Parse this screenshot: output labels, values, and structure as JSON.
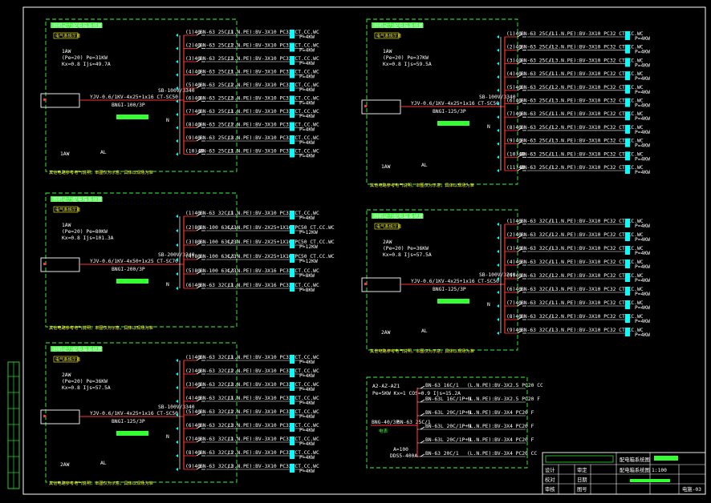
{
  "colors": {
    "background": "#000000",
    "frame": "#ffffff",
    "panel_border": "#33ff33",
    "bus": "#ff3333",
    "breaker": "#ffffff",
    "arrow": "#00ffff",
    "tag": "#00ffff",
    "yellow_text": "#ffff33",
    "green_text": "#33ff33",
    "label_box": "#ffff33"
  },
  "panels": [
    {
      "id": "panel-1",
      "header": "照明动力配电箱系统图",
      "sub_header": "电气系统示意",
      "note": "其他电路参考电气说明，本图仅为示意，具体以现场为准",
      "load_info": [
        "1AW",
        "(Pe=20) Pe=31KW",
        "Kx=0.8 Ijs=49.7A"
      ],
      "feeder_cable": "YJV-0.6/1KV-4x25+1x16 CT-SC50",
      "main_breaker": "BNGI-100/3P",
      "spd": "SB-100V/3340",
      "bus_label": "BNGI-100/3P",
      "footer_tag": "1AW",
      "footer_code": "AL",
      "circuits": [
        {
          "breaker": "(1)40",
          "device": "BN-63 25C/1",
          "desc": "L1.N.PE):BV-3X10 PC32 CT.CC.WC",
          "load": "P=4KW"
        },
        {
          "breaker": "(2)40",
          "device": "BN-63 25C/1",
          "desc": "L2.N.PE):BV-3X10 PC32 CT.CC.WC",
          "load": "P=4KW"
        },
        {
          "breaker": "(3)40",
          "device": "BN-63 25C/1",
          "desc": "L3.N.PE):BV-3X10 PC32 CT.CC.WC",
          "load": "P=4KW"
        },
        {
          "breaker": "(4)40",
          "device": "BN-63 25C/1",
          "desc": "L1.N.PE):BV-3X10 PC32 CT.CC.WC",
          "load": "P=4KW"
        },
        {
          "breaker": "(5)40",
          "device": "BN-63 25C/1",
          "desc": "L2.N.PE):BV-3X10 PC32 CT.CC.WC",
          "load": "P=4KW"
        },
        {
          "breaker": "(6)40",
          "device": "BN-63 25C/1",
          "desc": "L3.N.PE):BV-3X10 PC32 CT.CC.WC",
          "load": "P=4KW"
        },
        {
          "breaker": "(7)40",
          "device": "BN-63 25C/1",
          "desc": "L1.N.PE):BV-3X10 PC32 CT.CC.WC",
          "load": "P=4KW"
        },
        {
          "breaker": "(8)40",
          "device": "BN-63 25C/1",
          "desc": "L2.N.PE):BV-3X10 PC32 CT.CC.WC",
          "load": "P=4KW"
        },
        {
          "breaker": "(9)40",
          "device": "BN-63 25C/1",
          "desc": "L3.N.PE):BV-3X10 PC32 CT.CC.WC",
          "load": "P=4KW"
        },
        {
          "breaker": "(10)40",
          "device": "BN-63 25C/1",
          "desc": "L1.N.PE):BV-3X10 PC32 CT.CC.WC",
          "load": "P=4KW"
        }
      ]
    },
    {
      "id": "panel-2",
      "header": "照明动力配电箱系统图",
      "sub_header": "电气系统示意",
      "note": "其他电路参考电气说明，本图仅为示意，具体以现场为准",
      "load_info": [
        "1AW",
        "(Pe=20) Pe=80KW",
        "Kx=0.8 Ijs=101.3A"
      ],
      "feeder_cable": "YJV-0.6/1KV-4x50+1x25 CT-SC70",
      "main_breaker": "BNGI-200/3P",
      "spd": "SB-200V/3340",
      "bus_label": "BNGI-200/3P",
      "footer_tag": "",
      "footer_code": "",
      "circuits": [
        {
          "breaker": "(1)40",
          "device": "BN-63 32C/1",
          "desc": "L1.N.PE):BV-3X10 PC32 CT.CC.WC",
          "load": "P=4KW"
        },
        {
          "breaker": "(2)80",
          "device": "BN-100 63C/3",
          "desc": "L1.N.PE):BV-2X25+1X16 PC50 CT.CC.WC",
          "load": "P=12KW"
        },
        {
          "breaker": "(3)80",
          "device": "BN-100 63C/3",
          "desc": "L2.N.PE):BV-2X25+1X16 PC50 CT.CC.WC",
          "load": "P=12KW"
        },
        {
          "breaker": "(4)80",
          "device": "BN-100 63C/3",
          "desc": "L3.N.PE):BV-2X25+1X16 PC50 CT.CC.WC",
          "load": "P=12KW"
        },
        {
          "breaker": "(5)80",
          "device": "BN-100 63C/3",
          "desc": "L3.N.PE):BV-3X16 PC32 CT.CC.WC",
          "load": "P=8KW"
        },
        {
          "breaker": "(6)40",
          "device": "BN-63 32C/1",
          "desc": "L1.N.PE):BV-3X16 PC32 CT.CC.WC",
          "load": "P=8KW"
        }
      ]
    },
    {
      "id": "panel-3",
      "header": "照明动力配电箱系统图",
      "sub_header": "电气系统示意",
      "note": "其他电路参考电气说明，本图仅为示意，具体以现场为准",
      "load_info": [
        "2AW",
        "(Pe=20) Pe=36KW",
        "Kx=0.8 Ijs=57.5A"
      ],
      "feeder_cable": "YJV-0.6/1KV-4x25+1x16 CT-SC50",
      "main_breaker": "BNGI-125/3P",
      "spd": "SB-100V/3340",
      "bus_label": "BNGI-125/3P",
      "footer_tag": "2AW",
      "footer_code": "AL",
      "circuits": [
        {
          "breaker": "(1)40",
          "device": "BN-63 32C/1",
          "desc": "L1.N.PE):BV-3X10 PC32 CT.CC.WC",
          "load": "P=4KW"
        },
        {
          "breaker": "(2)40",
          "device": "BN-63 32C/1",
          "desc": "L2.N.PE):BV-3X10 PC32 CT.CC.WC",
          "load": "P=4KW"
        },
        {
          "breaker": "(3)40",
          "device": "BN-63 32C/1",
          "desc": "L3.N.PE):BV-3X10 PC32 CT.CC.WC",
          "load": "P=4KW"
        },
        {
          "breaker": "(4)40",
          "device": "BN-63 32C/1",
          "desc": "L1.N.PE):BV-3X10 PC32 CT.CC.WC",
          "load": "P=4KW"
        },
        {
          "breaker": "(5)40",
          "device": "BN-63 32C/1",
          "desc": "L2.N.PE):BV-3X10 PC32 CT.CC.WC",
          "load": "P=4KW"
        },
        {
          "breaker": "(6)40",
          "device": "BN-63 32C/1",
          "desc": "L3.N.PE):BV-3X10 PC32 CT.CC.WC",
          "load": "P=4KW"
        },
        {
          "breaker": "(7)40",
          "device": "BN-63 32C/1",
          "desc": "L1.N.PE):BV-3X10 PC32 CT.CC.WC",
          "load": "P=4KW"
        },
        {
          "breaker": "(8)40",
          "device": "BN-63 32C/1",
          "desc": "L2.N.PE):BV-3X10 PC32 CT.CC.WC",
          "load": "P=4KW"
        },
        {
          "breaker": "(9)40",
          "device": "BN-63 32C/1",
          "desc": "L3.N.PE):BV-3X10 PC32 CT.CC.WC",
          "load": "P=4KW"
        }
      ]
    },
    {
      "id": "panel-4",
      "header": "照明动力配电箱系统图",
      "sub_header": "电气系统示意",
      "note": "其他电路参考电气说明，本图仅为示意，具体以现场为准",
      "load_info": [
        "1AW",
        "(Pe=20) Pe=37KW",
        "Kx=0.8 Ijs=59.5A"
      ],
      "feeder_cable": "YJV-0.6/1KV-4x25+1x16 CT-SC50",
      "main_breaker": "BNGI-125/3P",
      "spd": "SB-100V/3340",
      "bus_label": "BNGI-125/3P",
      "footer_tag": "1AW",
      "footer_code": "AL",
      "circuits": [
        {
          "breaker": "(1)40",
          "device": "BN-63 25C/1",
          "desc": "(L1.N.PE):BV-3X10 PC32 CT.CC.WC",
          "load": "P=4KW"
        },
        {
          "breaker": "(2)40",
          "device": "BN-63 25C/1",
          "desc": "(L2.N.PE):BV-3X10 PC32 CT.CC.WC",
          "load": "P=4KW"
        },
        {
          "breaker": "(3)40",
          "device": "BN-63 25C/1",
          "desc": "(L3.N.PE):BV-3X10 PC32 CT.CC.WC",
          "load": "P=4KW"
        },
        {
          "breaker": "(4)40",
          "device": "BN-63 25C/1",
          "desc": "(L1.N.PE):BV-3X10 PC32 CT.CC.WC",
          "load": "P=4KW"
        },
        {
          "breaker": "(5)40",
          "device": "BN-63 25C/1",
          "desc": "(L2.N.PE):BV-3X10 PC32 CT.CC.WC",
          "load": "P=4KW"
        },
        {
          "breaker": "(6)40",
          "device": "BN-63 25C/1",
          "desc": "(L3.N.PE):BV-3X10 PC32 CT.CC.WC",
          "load": "P=4KW"
        },
        {
          "breaker": "(7)40",
          "device": "BN-63 25C/1",
          "desc": "(L1.N.PE):BV-3X10 PC32 CT.CC.WC",
          "load": "P=4KW"
        },
        {
          "breaker": "(8)40",
          "device": "BN-63 25C/1",
          "desc": "(L2.N.PE):BV-3X10 PC32 CT.CC.WC",
          "load": "P=4KW"
        },
        {
          "breaker": "(9)40",
          "device": "BN-63 25C/1",
          "desc": "(L3.N.PE):BV-3X10 PC32 CT.CC.WC",
          "load": "P=4KW"
        },
        {
          "breaker": "(10)40",
          "device": "BN-63 25C/1",
          "desc": "(L1.N.PE):BV-3X10 PC32 CT.CC.WC",
          "load": "P=4KW"
        },
        {
          "breaker": "(11)40",
          "device": "BN-63 25C/1",
          "desc": "(L2.N.PE):BV-3X10 PC32 CT.CC.WC",
          "load": "P=4KW"
        }
      ]
    },
    {
      "id": "panel-5",
      "header": "照明动力配电箱系统图",
      "sub_header": "电气系统示意",
      "note": "其他电路参考电气说明，本图仅为示意，具体以现场为准",
      "load_info": [
        "2AW",
        "(Pe=20) Pe=36KW",
        "Kx=0.8 Ijs=57.5A"
      ],
      "feeder_cable": "YJV-0.6/1KV-4x25+1x16 CT-SC50",
      "main_breaker": "BNGI-125/3P",
      "spd": "SB-100V/3340",
      "bus_label": "BNGI-125/3P",
      "footer_tag": "2AW",
      "footer_code": "AL",
      "circuits": [
        {
          "breaker": "(1)40",
          "device": "BN-63 32C/1",
          "desc": "(L1.N.PE):BV-3X10 PC32 CT.CC.WC",
          "load": "P=4KW"
        },
        {
          "breaker": "(2)40",
          "device": "BN-63 32C/1",
          "desc": "(L2.N.PE):BV-3X10 PC32 CT.CC.WC",
          "load": "P=4KW"
        },
        {
          "breaker": "(3)40",
          "device": "BN-63 32C/1",
          "desc": "(L3.N.PE):BV-3X10 PC32 CT.CC.WC",
          "load": "P=4KW"
        },
        {
          "breaker": "(4)40",
          "device": "BN-63 32C/1",
          "desc": "(L1.N.PE):BV-3X10 PC32 CT.CC.WC",
          "load": "P=4KW"
        },
        {
          "breaker": "(5)40",
          "device": "BN-63 32C/1",
          "desc": "(L2.N.PE):BV-3X10 PC32 CT.CC.WC",
          "load": "P=4KW"
        },
        {
          "breaker": "(6)40",
          "device": "BN-63 32C/1",
          "desc": "(L3.N.PE):BV-3X10 PC32 CT.CC.WC",
          "load": "P=4KW"
        },
        {
          "breaker": "(7)40",
          "device": "BN-63 32C/1",
          "desc": "(L1.N.PE):BV-3X10 PC32 CT.CC.WC",
          "load": "P=4KW"
        },
        {
          "breaker": "(8)40",
          "device": "BN-63 32C/1",
          "desc": "(L2.N.PE):BV-3X10 PC32 CT.CC.WC",
          "load": "P=4KW"
        },
        {
          "breaker": "(9)40",
          "device": "BN-63 32C/1",
          "desc": "(L3.N.PE):BV-3X10 PC32 CT.CC.WC",
          "load": "P=4KW"
        }
      ]
    }
  ],
  "small_panel": {
    "label": "A2-AZ-AZ1",
    "load_info": "Pe=5KW Kx=1 COS=0.9 Ijs=15.2A",
    "incoming": "BNG-40/3P",
    "rcd": "BN-63 25C/1",
    "meter": "DDS5",
    "note_1": "电表",
    "note_2": "A=100",
    "note_3": "DDS5-400A",
    "circuits": [
      {
        "device": "BN-63 16C/1",
        "desc": "(L.N.PE):BV-3X2.5 PC20 CC"
      },
      {
        "device": "BN-63L 16C/1P+N",
        "desc": "(L.N.PE):BV-3X2.5 PC20 F"
      },
      {
        "device": "BN-63L 20C/1P+N",
        "desc": "(L.N.PE):BV-3X4 PC20 F"
      },
      {
        "device": "BN-63L 20C/1P+N",
        "desc": "(L.N.PE):BV-3X4 PC20 F"
      },
      {
        "device": "BN-63L 20C/1P+N",
        "desc": "(L.N.PE):BV-3X4 PC20 F"
      },
      {
        "device": "BN-63 20C/1",
        "desc": "(L.N.PE):BV-3X4 PC20 CC"
      }
    ]
  },
  "title_block": {
    "project": "配电箱系统图",
    "drawing_name": "配电箱系统图",
    "scale": "1:100",
    "sheet": "电施-03",
    "labels": [
      "设计",
      "校对",
      "审核",
      "审定",
      "日期",
      "图号"
    ]
  }
}
